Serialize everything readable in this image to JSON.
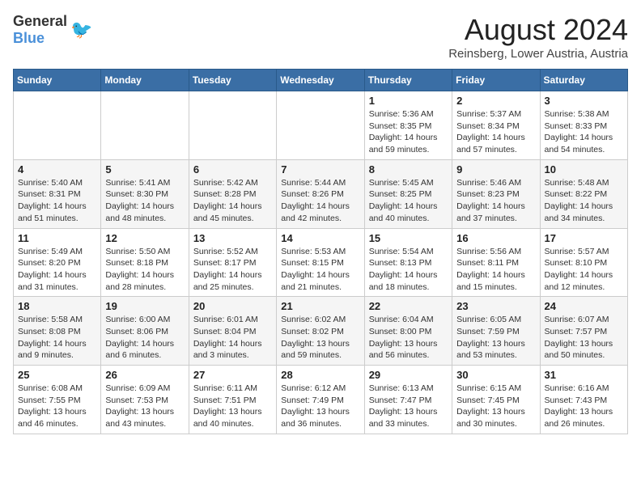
{
  "header": {
    "logo_general": "General",
    "logo_blue": "Blue",
    "month_year": "August 2024",
    "location": "Reinsberg, Lower Austria, Austria"
  },
  "weekdays": [
    "Sunday",
    "Monday",
    "Tuesday",
    "Wednesday",
    "Thursday",
    "Friday",
    "Saturday"
  ],
  "weeks": [
    [
      {
        "day": "",
        "info": ""
      },
      {
        "day": "",
        "info": ""
      },
      {
        "day": "",
        "info": ""
      },
      {
        "day": "",
        "info": ""
      },
      {
        "day": "1",
        "info": "Sunrise: 5:36 AM\nSunset: 8:35 PM\nDaylight: 14 hours and 59 minutes."
      },
      {
        "day": "2",
        "info": "Sunrise: 5:37 AM\nSunset: 8:34 PM\nDaylight: 14 hours and 57 minutes."
      },
      {
        "day": "3",
        "info": "Sunrise: 5:38 AM\nSunset: 8:33 PM\nDaylight: 14 hours and 54 minutes."
      }
    ],
    [
      {
        "day": "4",
        "info": "Sunrise: 5:40 AM\nSunset: 8:31 PM\nDaylight: 14 hours and 51 minutes."
      },
      {
        "day": "5",
        "info": "Sunrise: 5:41 AM\nSunset: 8:30 PM\nDaylight: 14 hours and 48 minutes."
      },
      {
        "day": "6",
        "info": "Sunrise: 5:42 AM\nSunset: 8:28 PM\nDaylight: 14 hours and 45 minutes."
      },
      {
        "day": "7",
        "info": "Sunrise: 5:44 AM\nSunset: 8:26 PM\nDaylight: 14 hours and 42 minutes."
      },
      {
        "day": "8",
        "info": "Sunrise: 5:45 AM\nSunset: 8:25 PM\nDaylight: 14 hours and 40 minutes."
      },
      {
        "day": "9",
        "info": "Sunrise: 5:46 AM\nSunset: 8:23 PM\nDaylight: 14 hours and 37 minutes."
      },
      {
        "day": "10",
        "info": "Sunrise: 5:48 AM\nSunset: 8:22 PM\nDaylight: 14 hours and 34 minutes."
      }
    ],
    [
      {
        "day": "11",
        "info": "Sunrise: 5:49 AM\nSunset: 8:20 PM\nDaylight: 14 hours and 31 minutes."
      },
      {
        "day": "12",
        "info": "Sunrise: 5:50 AM\nSunset: 8:18 PM\nDaylight: 14 hours and 28 minutes."
      },
      {
        "day": "13",
        "info": "Sunrise: 5:52 AM\nSunset: 8:17 PM\nDaylight: 14 hours and 25 minutes."
      },
      {
        "day": "14",
        "info": "Sunrise: 5:53 AM\nSunset: 8:15 PM\nDaylight: 14 hours and 21 minutes."
      },
      {
        "day": "15",
        "info": "Sunrise: 5:54 AM\nSunset: 8:13 PM\nDaylight: 14 hours and 18 minutes."
      },
      {
        "day": "16",
        "info": "Sunrise: 5:56 AM\nSunset: 8:11 PM\nDaylight: 14 hours and 15 minutes."
      },
      {
        "day": "17",
        "info": "Sunrise: 5:57 AM\nSunset: 8:10 PM\nDaylight: 14 hours and 12 minutes."
      }
    ],
    [
      {
        "day": "18",
        "info": "Sunrise: 5:58 AM\nSunset: 8:08 PM\nDaylight: 14 hours and 9 minutes."
      },
      {
        "day": "19",
        "info": "Sunrise: 6:00 AM\nSunset: 8:06 PM\nDaylight: 14 hours and 6 minutes."
      },
      {
        "day": "20",
        "info": "Sunrise: 6:01 AM\nSunset: 8:04 PM\nDaylight: 14 hours and 3 minutes."
      },
      {
        "day": "21",
        "info": "Sunrise: 6:02 AM\nSunset: 8:02 PM\nDaylight: 13 hours and 59 minutes."
      },
      {
        "day": "22",
        "info": "Sunrise: 6:04 AM\nSunset: 8:00 PM\nDaylight: 13 hours and 56 minutes."
      },
      {
        "day": "23",
        "info": "Sunrise: 6:05 AM\nSunset: 7:59 PM\nDaylight: 13 hours and 53 minutes."
      },
      {
        "day": "24",
        "info": "Sunrise: 6:07 AM\nSunset: 7:57 PM\nDaylight: 13 hours and 50 minutes."
      }
    ],
    [
      {
        "day": "25",
        "info": "Sunrise: 6:08 AM\nSunset: 7:55 PM\nDaylight: 13 hours and 46 minutes."
      },
      {
        "day": "26",
        "info": "Sunrise: 6:09 AM\nSunset: 7:53 PM\nDaylight: 13 hours and 43 minutes."
      },
      {
        "day": "27",
        "info": "Sunrise: 6:11 AM\nSunset: 7:51 PM\nDaylight: 13 hours and 40 minutes."
      },
      {
        "day": "28",
        "info": "Sunrise: 6:12 AM\nSunset: 7:49 PM\nDaylight: 13 hours and 36 minutes."
      },
      {
        "day": "29",
        "info": "Sunrise: 6:13 AM\nSunset: 7:47 PM\nDaylight: 13 hours and 33 minutes."
      },
      {
        "day": "30",
        "info": "Sunrise: 6:15 AM\nSunset: 7:45 PM\nDaylight: 13 hours and 30 minutes."
      },
      {
        "day": "31",
        "info": "Sunrise: 6:16 AM\nSunset: 7:43 PM\nDaylight: 13 hours and 26 minutes."
      }
    ]
  ]
}
